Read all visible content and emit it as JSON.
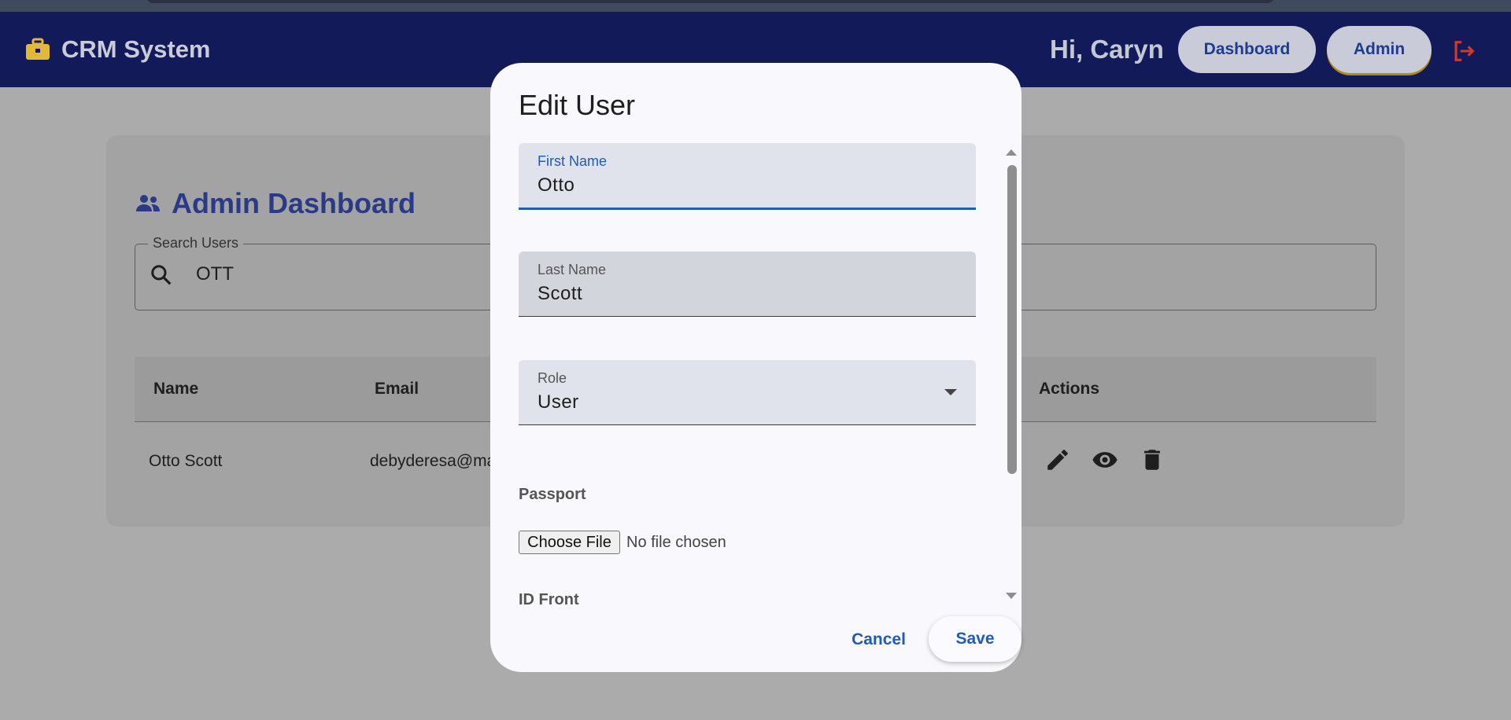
{
  "appbar": {
    "title": "CRM System",
    "greeting": "Hi, Caryn",
    "nav": {
      "dashboard": "Dashboard",
      "admin": "Admin"
    }
  },
  "page": {
    "title": "Admin Dashboard",
    "search": {
      "label": "Search Users",
      "value": "OTT"
    },
    "table": {
      "headers": {
        "name": "Name",
        "email": "Email",
        "actions": "Actions"
      },
      "rows": [
        {
          "name": "Otto Scott",
          "email": "debyderesa@ma"
        }
      ]
    }
  },
  "modal": {
    "title": "Edit User",
    "first_name": {
      "label": "First Name",
      "value": "Otto"
    },
    "last_name": {
      "label": "Last Name",
      "value": "Scott"
    },
    "role": {
      "label": "Role",
      "value": "User"
    },
    "passport_label": "Passport",
    "file_button": "Choose File",
    "file_status": "No file chosen",
    "id_front_label": "ID Front",
    "cancel": "Cancel",
    "save": "Save"
  },
  "colors": {
    "appbar": "#121a5a",
    "accent": "#1f5bb8",
    "brand_icon": "#e0b93a",
    "logout": "#d0392b"
  },
  "icons": [
    "briefcase-icon",
    "logout-icon",
    "people-icon",
    "search-icon",
    "edit-icon",
    "view-icon",
    "delete-icon",
    "dropdown-arrow-icon"
  ]
}
